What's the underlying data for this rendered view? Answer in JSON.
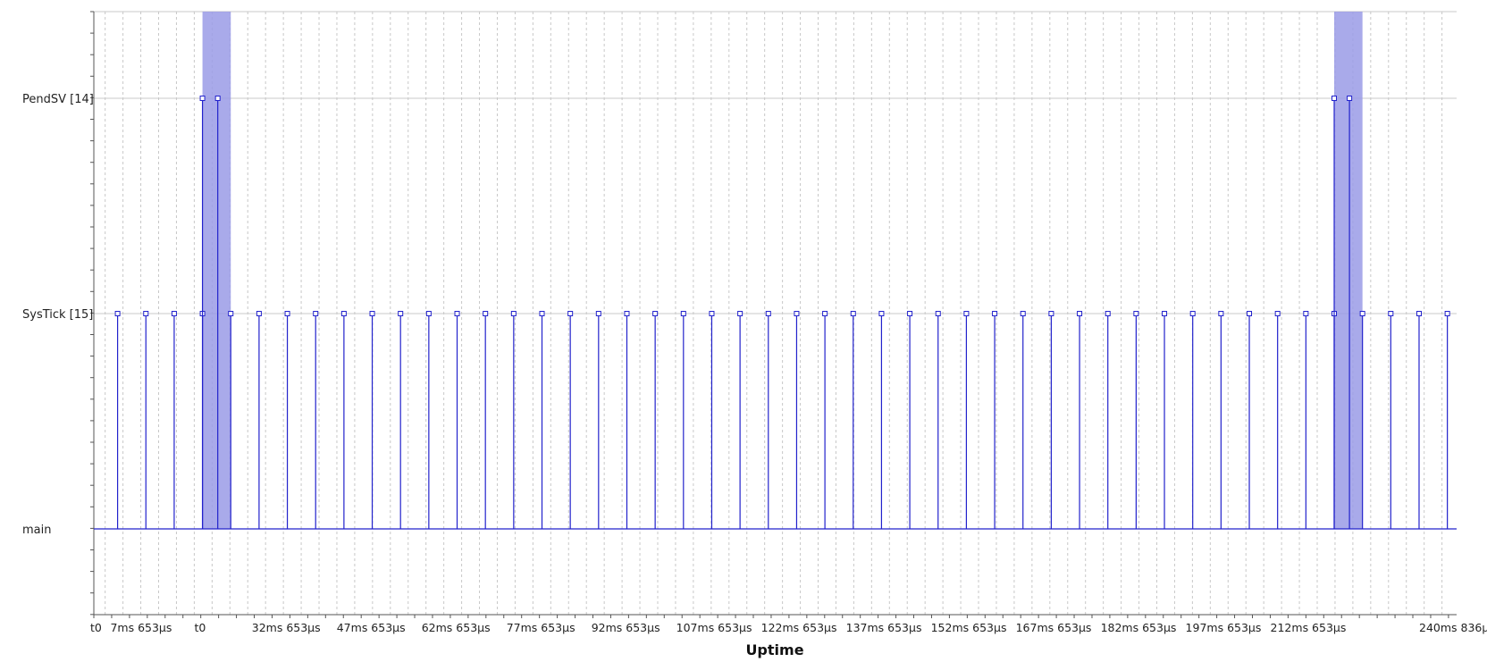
{
  "chart_data": {
    "type": "line",
    "title": "",
    "xlabel": "Uptime",
    "ylabel": "",
    "xlim_ms": [
      0,
      240.836
    ],
    "grid": true,
    "y_levels": [
      {
        "name": "main",
        "level": 0
      },
      {
        "name": "SysTick [15]",
        "level": 1
      },
      {
        "name": "PendSV [14]",
        "level": 2
      }
    ],
    "x_tick_labels": [
      {
        "at_ms": 0,
        "label": "t0"
      },
      {
        "at_ms": 7.653,
        "label": "7ms 653µs"
      },
      {
        "at_ms": 22.5,
        "label": "t0"
      },
      {
        "at_ms": 32.653,
        "label": "32ms 653µs"
      },
      {
        "at_ms": 47.653,
        "label": "47ms 653µs"
      },
      {
        "at_ms": 62.653,
        "label": "62ms 653µs"
      },
      {
        "at_ms": 77.653,
        "label": "77ms 653µs"
      },
      {
        "at_ms": 92.653,
        "label": "92ms 653µs"
      },
      {
        "at_ms": 107.653,
        "label": "107ms 653µs"
      },
      {
        "at_ms": 122.653,
        "label": "122ms 653µs"
      },
      {
        "at_ms": 137.653,
        "label": "137ms 653µs"
      },
      {
        "at_ms": 152.653,
        "label": "152ms 653µs"
      },
      {
        "at_ms": 167.653,
        "label": "167ms 653µs"
      },
      {
        "at_ms": 182.653,
        "label": "182ms 653µs"
      },
      {
        "at_ms": 197.653,
        "label": "197ms 653µs"
      },
      {
        "at_ms": 212.653,
        "label": "212ms 653µs"
      },
      {
        "at_ms": 240.836,
        "label": "240ms 836µs"
      }
    ],
    "systick_events_ms": [
      4.2,
      9.2,
      14.2,
      19.2,
      24.2,
      29.2,
      34.2,
      39.2,
      44.2,
      49.2,
      54.2,
      59.2,
      64.2,
      69.2,
      74.2,
      79.2,
      84.2,
      89.2,
      94.2,
      99.2,
      104.2,
      109.2,
      114.2,
      119.2,
      124.2,
      129.2,
      134.2,
      139.2,
      144.2,
      149.2,
      154.2,
      159.2,
      164.2,
      169.2,
      174.2,
      179.2,
      184.2,
      189.2,
      194.2,
      199.2,
      204.2,
      209.2,
      214.2,
      219.2,
      224.2,
      229.2,
      234.2,
      239.2
    ],
    "pendsv_events_ms": [
      19.2,
      21.9,
      219.2,
      221.9
    ],
    "highlight_ranges_ms": [
      [
        19.2,
        24.2
      ],
      [
        219.2,
        224.2
      ]
    ],
    "colors": {
      "line": "#2222cc",
      "highlight": "#9a9be6",
      "grid": "#c8c8c8",
      "axis": "#555555"
    }
  }
}
